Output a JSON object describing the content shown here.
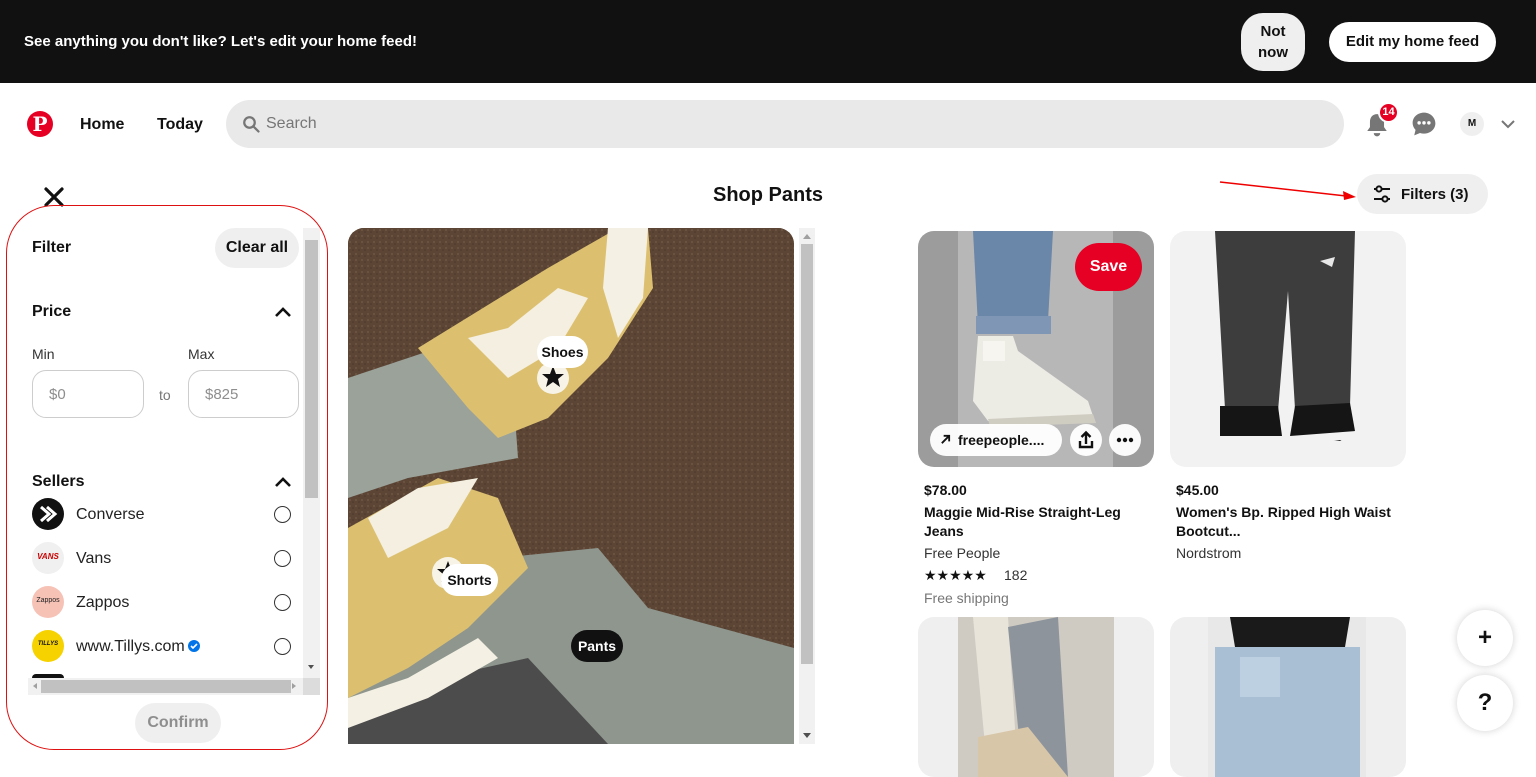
{
  "banner": {
    "message": "See anything you don't like? Let's edit your home feed!",
    "not_now_line1": "Not",
    "not_now_line2": "now",
    "edit_label": "Edit my home feed"
  },
  "header": {
    "logo_letter": "P",
    "nav": {
      "home": "Home",
      "today": "Today"
    },
    "search_placeholder": "Search",
    "notification_count": "14",
    "avatar_initial": "M",
    "brand_color": "#e60023"
  },
  "page": {
    "title": "Shop Pants",
    "filters_label": "Filters (3)"
  },
  "filter_panel": {
    "title": "Filter",
    "clear_all": "Clear all",
    "price": {
      "heading": "Price",
      "min_label": "Min",
      "max_label": "Max",
      "min_placeholder": "$0",
      "max_placeholder": "$825",
      "to_label": "to"
    },
    "sellers": {
      "heading": "Sellers",
      "items": [
        {
          "name": "Converse",
          "logo_text": "",
          "selected": false
        },
        {
          "name": "Vans",
          "logo_text": "VANS",
          "selected": false
        },
        {
          "name": "Zappos",
          "logo_text": "Zappos",
          "selected": false
        },
        {
          "name": "www.Tillys.com",
          "logo_text": "TILLYS",
          "verified": true,
          "selected": false
        }
      ]
    },
    "confirm": "Confirm"
  },
  "main_image": {
    "tags": {
      "shoes": "Shoes",
      "shorts": "Shorts",
      "pants": "Pants"
    }
  },
  "products": [
    {
      "price": "$78.00",
      "title": "Maggie Mid-Rise Straight-Leg Jeans",
      "seller": "Free People",
      "rating_stars": "★★★★★",
      "rating_count": "182",
      "shipping": "Free shipping",
      "link_text": "freepeople....",
      "save_label": "Save"
    },
    {
      "price": "$45.00",
      "title": "Women's Bp. Ripped High Waist Bootcut...",
      "seller": "Nordstrom"
    }
  ],
  "fabs": {
    "add": "+",
    "help": "?"
  }
}
